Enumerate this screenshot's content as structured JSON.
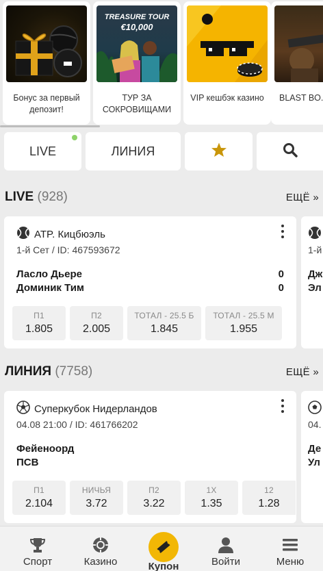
{
  "promos": [
    {
      "caption": "Бонус за первый депозит!",
      "image_text": ""
    },
    {
      "caption": "ТУР ЗА СОКРОВИЩАМИ",
      "image_text": "TREASURE TOUR €10,000"
    },
    {
      "caption": "VIP кешбэк казино",
      "image_text": ""
    },
    {
      "caption": "BLAST BO... BOOST",
      "image_text": ""
    }
  ],
  "nav": {
    "live_label": "LIVE",
    "line_label": "ЛИНИЯ"
  },
  "live_section": {
    "title": "LIVE",
    "count": "(928)",
    "more": "ЕЩЁ »",
    "event": {
      "league": "ATP. Кицбюэль",
      "meta": "1-й Сет / ID: 467593672",
      "team1": "Ласло Дьере",
      "team2": "Доминик Тим",
      "score1": "0",
      "score2": "0",
      "odds": [
        {
          "label": "П1",
          "value": "1.805"
        },
        {
          "label": "П2",
          "value": "2.005"
        },
        {
          "label": "ТОТАЛ - 25.5 Б",
          "value": "1.845"
        },
        {
          "label": "ТОТАЛ - 25.5 М",
          "value": "1.955"
        }
      ]
    },
    "peek": {
      "meta": "1-й",
      "team1": "Дж",
      "team2": "Эл"
    }
  },
  "line_section": {
    "title": "ЛИНИЯ",
    "count": "(7758)",
    "more": "ЕЩЁ »",
    "event": {
      "league": "Суперкубок Нидерландов",
      "meta": "04.08 21:00 / ID: 461766202",
      "team1": "Фейеноорд",
      "team2": "ПСВ",
      "odds": [
        {
          "label": "П1",
          "value": "2.104"
        },
        {
          "label": "НИЧЬЯ",
          "value": "3.72"
        },
        {
          "label": "П2",
          "value": "3.22"
        },
        {
          "label": "1X",
          "value": "1.35"
        },
        {
          "label": "12",
          "value": "1.28"
        }
      ]
    },
    "peek": {
      "meta": "04.",
      "team1": "Де",
      "team2": "Ул"
    }
  },
  "bottom_nav": [
    {
      "label": "Спорт",
      "icon": "trophy-icon"
    },
    {
      "label": "Казино",
      "icon": "casino-chip-icon"
    },
    {
      "label": "Купон",
      "icon": "coupon-ticket-icon"
    },
    {
      "label": "Войти",
      "icon": "user-icon"
    },
    {
      "label": "Меню",
      "icon": "menu-icon"
    }
  ],
  "colors": {
    "accent": "#f2b705",
    "background": "#ececec",
    "card": "#ffffff",
    "odd_bg": "#f0f0f0",
    "live_dot": "#8ed36a"
  }
}
